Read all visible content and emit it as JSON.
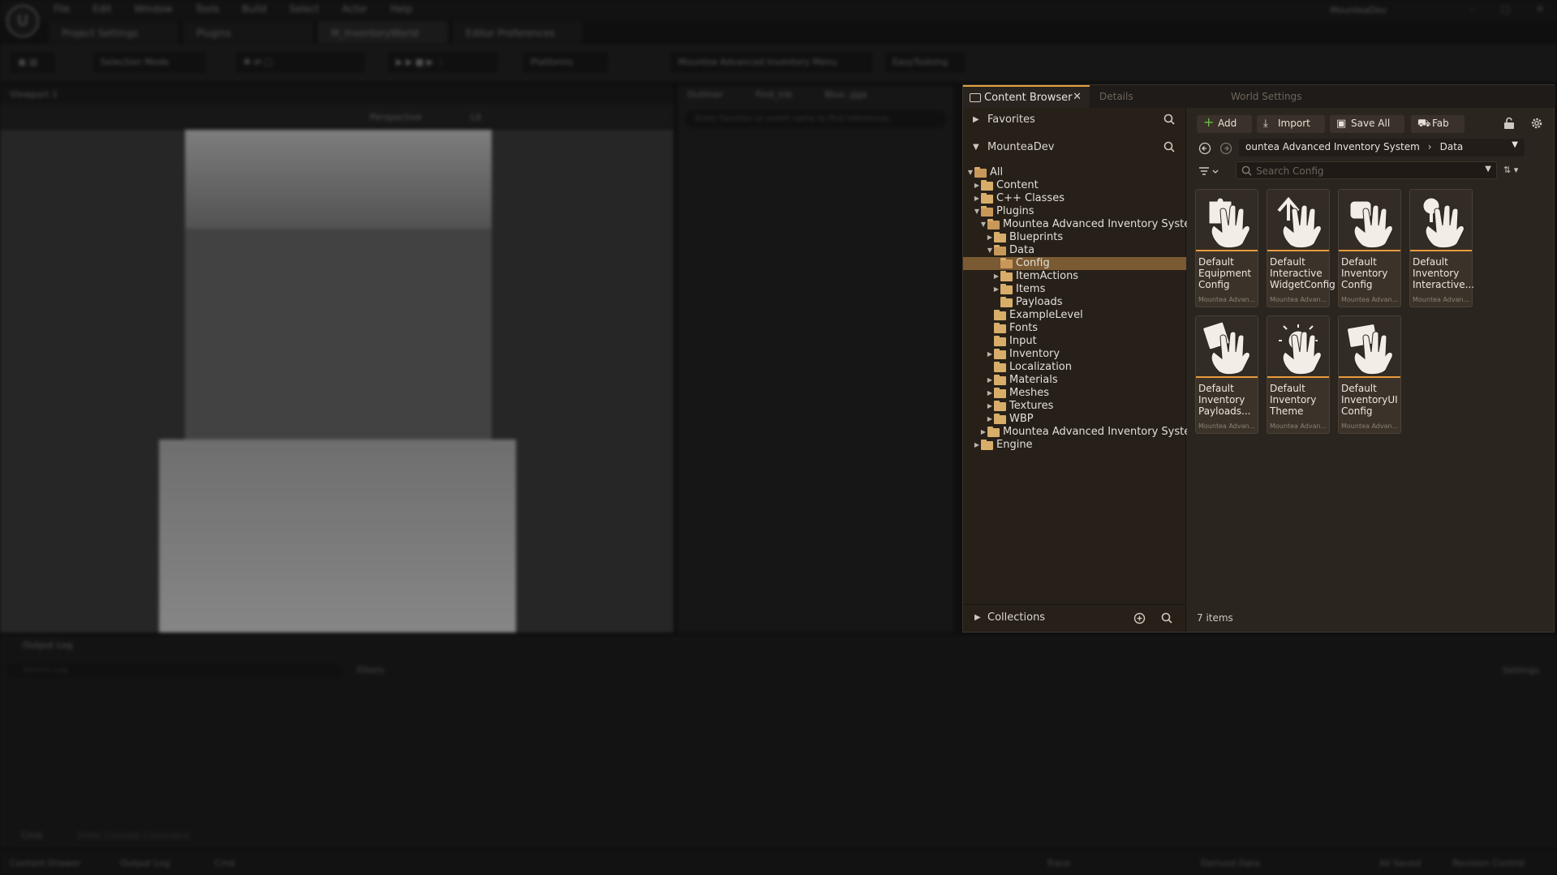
{
  "background": {
    "menu": [
      "File",
      "Edit",
      "Window",
      "Tools",
      "Build",
      "Select",
      "Actor",
      "Help"
    ],
    "project_name": "MounteaDev",
    "doc_tabs": [
      "Project Settings",
      "Plugins",
      "M_InventoryWorld",
      "Editor Preferences"
    ],
    "toolbar": {
      "mode": "Selection Mode",
      "platforms": "Platforms",
      "menu": "Mountea Advanced Inventory Menu",
      "easy": "EasyTodoing"
    },
    "viewport_tab": "Viewport 1",
    "viewport_mode": "Perspective",
    "viewport_lit": "Lit",
    "outliner_tabs": [
      "Outliner",
      "Find_Inb",
      "Blue..gga"
    ],
    "outliner_search_placeholder": "Enter function or event name to find references",
    "output_log_tab": "Output Log",
    "output_log_search_placeholder": "Search Log",
    "output_log_filters": "Filters",
    "output_log_settings": "Settings",
    "cmd_label": "Cmd",
    "console_placeholder": "Enter Console Command",
    "statusbar": [
      "Content Drawer",
      "Output Log",
      "Cmd",
      "Trace",
      "Derived Data",
      "All Saved",
      "Revision Control"
    ]
  },
  "content_browser": {
    "tab_label": "Content Browser",
    "tab2_label": "Details",
    "tab3_label": "World Settings",
    "favorites_label": "Favorites",
    "project_label": "MounteaDev",
    "collections_label": "Collections",
    "toolbar": {
      "add": "Add",
      "import": "Import",
      "save_all": "Save All",
      "fab": "Fab"
    },
    "path": [
      "ountea Advanced Inventory System",
      "Data"
    ],
    "search_placeholder": "Search Config",
    "item_count": "7 items",
    "tree": [
      {
        "label": "All",
        "depth": 0,
        "arrow": "open",
        "open": true
      },
      {
        "label": "Content",
        "depth": 1,
        "arrow": "closed",
        "open": false
      },
      {
        "label": "C++ Classes",
        "depth": 1,
        "arrow": "closed",
        "open": false
      },
      {
        "label": "Plugins",
        "depth": 1,
        "arrow": "open",
        "open": true
      },
      {
        "label": "Mountea Advanced Inventory System",
        "depth": 2,
        "arrow": "open",
        "open": true
      },
      {
        "label": "Blueprints",
        "depth": 3,
        "arrow": "closed",
        "open": false
      },
      {
        "label": "Data",
        "depth": 3,
        "arrow": "open",
        "open": true
      },
      {
        "label": "Config",
        "depth": 4,
        "arrow": "none",
        "open": true,
        "selected": true
      },
      {
        "label": "ItemActions",
        "depth": 4,
        "arrow": "closed",
        "open": false
      },
      {
        "label": "Items",
        "depth": 4,
        "arrow": "closed",
        "open": false
      },
      {
        "label": "Payloads",
        "depth": 4,
        "arrow": "none",
        "open": false
      },
      {
        "label": "ExampleLevel",
        "depth": 3,
        "arrow": "none",
        "open": false
      },
      {
        "label": "Fonts",
        "depth": 3,
        "arrow": "none",
        "open": false
      },
      {
        "label": "Input",
        "depth": 3,
        "arrow": "none",
        "open": false
      },
      {
        "label": "Inventory",
        "depth": 3,
        "arrow": "closed",
        "open": false
      },
      {
        "label": "Localization",
        "depth": 3,
        "arrow": "none",
        "open": false
      },
      {
        "label": "Materials",
        "depth": 3,
        "arrow": "closed",
        "open": false
      },
      {
        "label": "Meshes",
        "depth": 3,
        "arrow": "closed",
        "open": false
      },
      {
        "label": "Textures",
        "depth": 3,
        "arrow": "closed",
        "open": false
      },
      {
        "label": "WBP",
        "depth": 3,
        "arrow": "closed",
        "open": false
      },
      {
        "label": "Mountea Advanced Inventory System",
        "depth": 2,
        "arrow": "closed",
        "open": false
      },
      {
        "label": "Engine",
        "depth": 1,
        "arrow": "closed",
        "open": false
      }
    ],
    "assets": [
      {
        "name": "Default Equipment Config",
        "source": "Mountea Advan...",
        "icon": "puzzle-hand-icon"
      },
      {
        "name": "Default Interactive WidgetConfig",
        "source": "Mountea Advan...",
        "icon": "arrows-hand-icon"
      },
      {
        "name": "Default Inventory Config",
        "source": "Mountea Advan...",
        "icon": "bag-hand-icon"
      },
      {
        "name": "Default Inventory Interactive...",
        "source": "Mountea Advan...",
        "icon": "tree-hand-icon"
      },
      {
        "name": "Default Inventory Payloads...",
        "source": "Mountea Advan...",
        "icon": "card-hand-icon"
      },
      {
        "name": "Default Inventory Theme",
        "source": "Mountea Advan...",
        "icon": "sun-hand-icon"
      },
      {
        "name": "Default InventoryUI Config",
        "source": "Mountea Advan...",
        "icon": "screen-hand-icon"
      }
    ]
  }
}
